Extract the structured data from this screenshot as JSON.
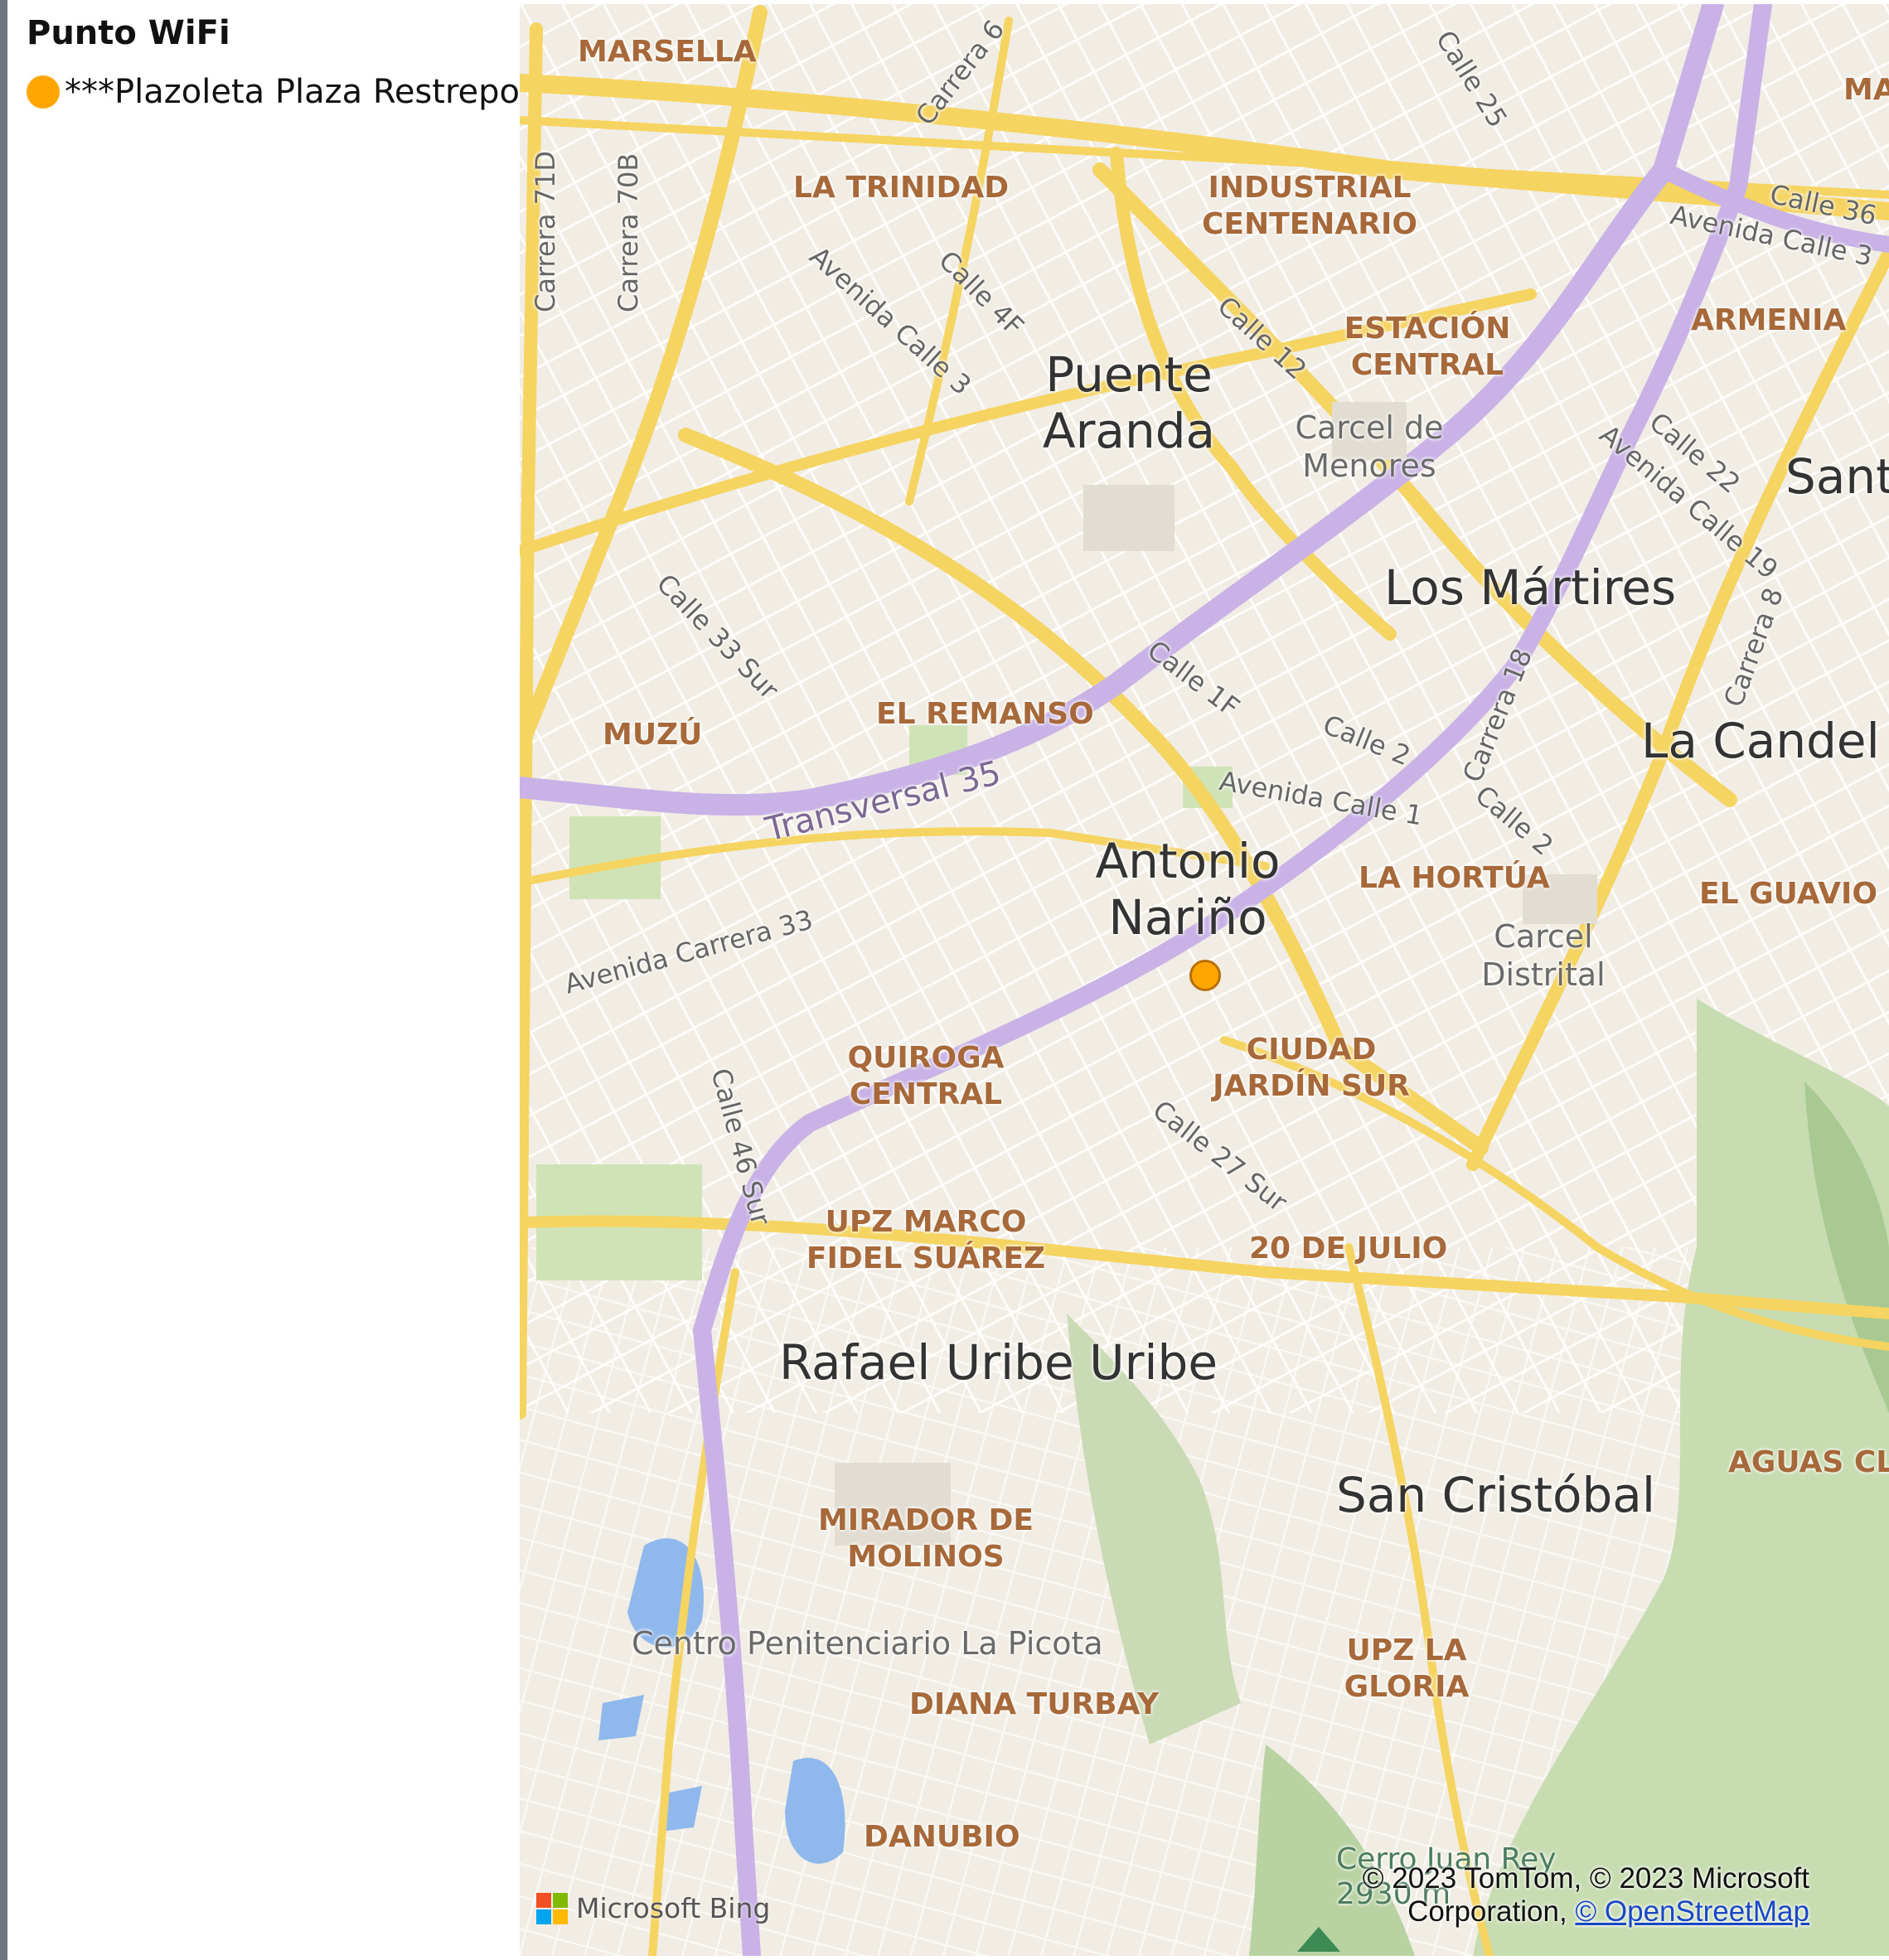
{
  "legend": {
    "title": "Punto WiFi",
    "items": [
      {
        "label": "***Plazoleta Plaza Restrepo",
        "color": "#FFA500"
      }
    ]
  },
  "map": {
    "districts": [
      "MARSELLA",
      "LA TRINIDAD",
      "INDUSTRIAL CENTENARIO",
      "ESTACIÓN CENTRAL",
      "ARMENIA",
      "MUZÚ",
      "EL REMANSO",
      "LA HORTÚA",
      "EL GUAVIO",
      "QUIROGA CENTRAL",
      "CIUDAD JARDÍN SUR",
      "UPZ MARCO FIDEL SUÁREZ",
      "20 DE JULIO",
      "MIRADOR DE MOLINOS",
      "DIANA TURBAY",
      "UPZ LA GLORIA",
      "DANUBIO",
      "AGUAS CL",
      "MA"
    ],
    "localities": [
      "Puente Aranda",
      "Los Mártires",
      "La Candel",
      "Antonio Nariño",
      "Rafael Uribe Uribe",
      "San Cristóbal",
      "Sant"
    ],
    "pois": [
      "Carcel de Menores",
      "Carcel Distrital",
      "Centro Penitenciario La Picota"
    ],
    "peak": {
      "name": "Cerro Juan Rey",
      "elevation": "2930 m"
    },
    "streets": [
      "Carrera 71D",
      "Carrera 70B",
      "Carrera 6",
      "Calle 25",
      "Calle 36",
      "Avenida Calle 3",
      "Avenida Calle 3",
      "Calle 4F",
      "Calle 12",
      "Calle 22",
      "Avenida Calle 19",
      "Carrera 8",
      "Calle 33 Sur",
      "Calle 1F",
      "Calle 2",
      "Carrera 18",
      "Avenida Calle 1",
      "Calle 2",
      "Avenida Carrera 33",
      "Calle 46 Sur",
      "Calle 27 Sur"
    ],
    "highways": [
      "Transversal 35"
    ],
    "provider": "Microsoft Bing",
    "attribution_line1": "© 2023 TomTom, © 2023 Microsoft",
    "attribution_line2": "Corporation, ",
    "attribution_link": "© OpenStreetMap",
    "colors": {
      "major_road": "#f7d566",
      "highway": "#c9b3e6",
      "park": "#cfe3b7",
      "water": "#8fb8ec",
      "land": "#f3efe6"
    }
  }
}
